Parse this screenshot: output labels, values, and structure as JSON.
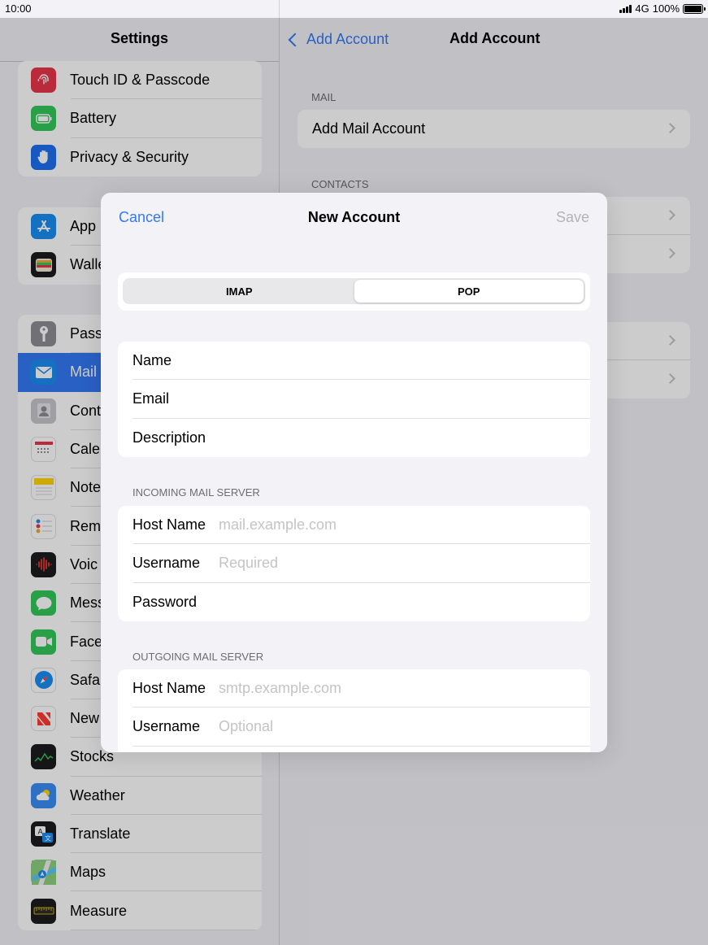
{
  "status_bar": {
    "time": "10:00",
    "network": "4G",
    "battery": "100%"
  },
  "sidebar": {
    "title": "Settings",
    "groups": [
      [
        {
          "label": "Touch ID & Passcode",
          "icon": "fingerprint-icon",
          "color": "#e8354a"
        },
        {
          "label": "Battery",
          "icon": "battery-icon",
          "color": "#34c759"
        },
        {
          "label": "Privacy & Security",
          "icon": "hand-icon",
          "color": "#1d6ff2"
        }
      ],
      [
        {
          "label": "App",
          "icon": "app-store-icon",
          "color": "#1a8cf0"
        },
        {
          "label": "Walle",
          "icon": "wallet-icon",
          "color": "#1c1c1e"
        }
      ],
      [
        {
          "label": "Pass",
          "icon": "key-icon",
          "color": "#8e8e93"
        },
        {
          "label": "Mail",
          "icon": "mail-icon",
          "color": "#1a8cf0",
          "selected": true
        },
        {
          "label": "Cont",
          "icon": "contacts-icon",
          "color": "#a2a2a6"
        },
        {
          "label": "Cale",
          "icon": "calendar-icon",
          "color": "#ffffff"
        },
        {
          "label": "Note",
          "icon": "notes-icon",
          "color": "#ffd60a"
        },
        {
          "label": "Rem",
          "icon": "reminders-icon",
          "color": "#ffffff"
        },
        {
          "label": "Voic",
          "icon": "voice-memos-icon",
          "color": "#1c1c1e"
        },
        {
          "label": "Mess",
          "icon": "messages-icon",
          "color": "#34c759"
        },
        {
          "label": "Face",
          "icon": "facetime-icon",
          "color": "#34c759"
        },
        {
          "label": "Safa",
          "icon": "safari-icon",
          "color": "#1a8cf0"
        },
        {
          "label": "New",
          "icon": "news-icon",
          "color": "#ffffff"
        },
        {
          "label": "Stocks",
          "icon": "stocks-icon",
          "color": "#1c1c1e"
        },
        {
          "label": "Weather",
          "icon": "weather-icon",
          "color": "#3a8df5"
        },
        {
          "label": "Translate",
          "icon": "translate-icon",
          "color": "#1c1c1e"
        },
        {
          "label": "Maps",
          "icon": "maps-icon",
          "color": "#5ac8fa"
        },
        {
          "label": "Measure",
          "icon": "measure-icon",
          "color": "#1c1c1e"
        }
      ]
    ]
  },
  "detail": {
    "back_label": "Add Account",
    "title": "Add Account",
    "mail_header": "MAIL",
    "mail_row": "Add Mail Account",
    "contacts_header": "CONTACTS"
  },
  "modal": {
    "cancel": "Cancel",
    "title": "New Account",
    "save": "Save",
    "segments": [
      "IMAP",
      "POP"
    ],
    "account_fields": [
      "Name",
      "Email",
      "Description"
    ],
    "incoming_header": "INCOMING MAIL SERVER",
    "incoming": {
      "host_label": "Host Name",
      "host_placeholder": "mail.example.com",
      "user_label": "Username",
      "user_placeholder": "Required",
      "pass_label": "Password"
    },
    "outgoing_header": "OUTGOING MAIL SERVER",
    "outgoing": {
      "host_label": "Host Name",
      "host_placeholder": "smtp.example.com",
      "user_label": "Username",
      "user_placeholder": "Optional"
    }
  }
}
